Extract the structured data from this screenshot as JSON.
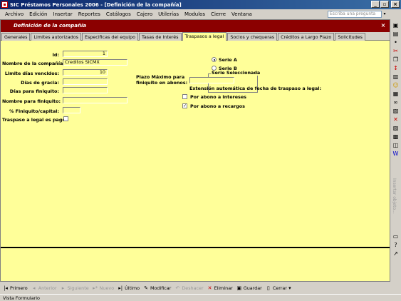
{
  "window": {
    "title": "SIC Préstamos Personales 2006 - [Definición de la compañía]"
  },
  "menu": [
    "Archivo",
    "Edición",
    "Insertar",
    "Reportes",
    "Catálogos",
    "Cajero",
    "Utilerías",
    "Modulos",
    "Cierre",
    "Ventana"
  ],
  "ask": {
    "placeholder": "Escriba una pregunta"
  },
  "form": {
    "header": "Definición de la compañía"
  },
  "tabs": [
    "Generales",
    "Limites autorizados",
    "Especificas del equipo",
    "Tasas de Interés",
    "Traspasos a legal",
    "Socios y chequeras",
    "Créditos a Largo Plazo",
    "Solicitudes"
  ],
  "active_tab": "Traspasos a legal",
  "fields": {
    "id_label": "Id:",
    "id_value": "1",
    "nombre_label": "Nombre de la compañía:",
    "nombre_value": "Creditos SICMX",
    "limite_label": "Limite días vencidos:",
    "limite_value": "10",
    "gracia_label": "Días de gracia:",
    "gracia_value": "",
    "finiquito_dias_label": "Días para finiquito:",
    "finiquito_dias_value": "",
    "nombre_finiquito_label": "Nombre para finiquito:",
    "nombre_finiquito_value": "",
    "pct_label": "% Finiquito/capital:",
    "pct_value": "",
    "traspaso_pago_label": "Traspaso a legal es pago:",
    "plazo_label_1": "Plazo Máximo para",
    "plazo_label_2": "finiquito en abonos:",
    "plazo_value": ""
  },
  "serie": {
    "title": "Serie Seleccionada",
    "option_a": "Serie A",
    "option_b": "Serie B",
    "selected": "A"
  },
  "extension": {
    "title": "Extensión automática de fecha de traspaso a legal:",
    "intereses": "Por abono a intereses",
    "recargos": "Por abono a recargos"
  },
  "nav": {
    "primero": "Primero",
    "anterior": "Anterior",
    "siguiente": "Siguiente",
    "nuevo": "Nuevo",
    "ultimo": "Último",
    "modificar": "Modificar",
    "deshacer": "Deshacer",
    "eliminar": "Eliminar",
    "guardar": "Guardar",
    "cerrar": "Cerrar"
  },
  "status": "Vista Formulario",
  "right_bar_text": "Insertar objeto...",
  "colors": {
    "form_bg": "#ffff99",
    "header": "#8b0000",
    "titlebar": "#0a246a"
  }
}
